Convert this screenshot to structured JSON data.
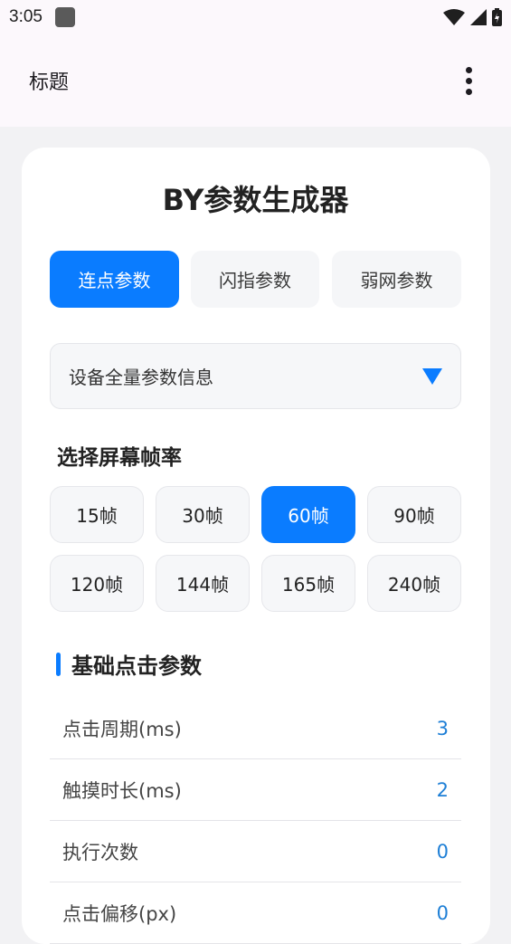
{
  "status_bar": {
    "time": "3:05"
  },
  "app_bar": {
    "title": "标题"
  },
  "card": {
    "title": "BY参数生成器",
    "tabs": [
      {
        "label": "连点参数",
        "active": true
      },
      {
        "label": "闪指参数",
        "active": false
      },
      {
        "label": "弱网参数",
        "active": false
      }
    ],
    "dropdown": {
      "selected": "设备全量参数信息"
    },
    "frame_rate_label": "选择屏幕帧率",
    "frame_rates": [
      {
        "label": "15帧",
        "active": false
      },
      {
        "label": "30帧",
        "active": false
      },
      {
        "label": "60帧",
        "active": true
      },
      {
        "label": "90帧",
        "active": false
      },
      {
        "label": "120帧",
        "active": false
      },
      {
        "label": "144帧",
        "active": false
      },
      {
        "label": "165帧",
        "active": false
      },
      {
        "label": "240帧",
        "active": false
      }
    ],
    "section_title": "基础点击参数",
    "params": [
      {
        "label": "点击周期(ms)",
        "value": "3"
      },
      {
        "label": "触摸时长(ms)",
        "value": "2"
      },
      {
        "label": "执行次数",
        "value": "0"
      },
      {
        "label": "点击偏移(px)",
        "value": "0"
      }
    ]
  },
  "colors": {
    "accent": "#0a7cff",
    "value_text": "#1e7fd6"
  }
}
